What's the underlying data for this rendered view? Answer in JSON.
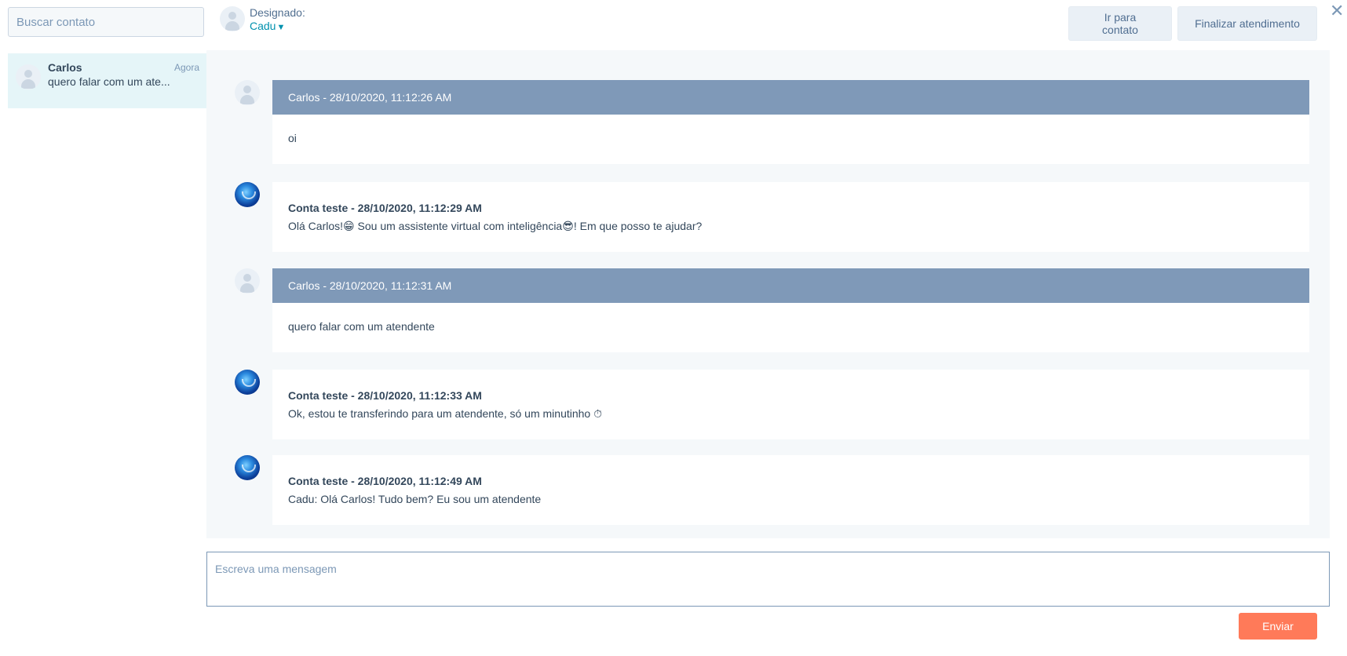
{
  "sidebar": {
    "search_placeholder": "Buscar contato",
    "contacts": [
      {
        "name": "Carlos",
        "time": "Agora",
        "preview": "quero falar com um ate..."
      }
    ]
  },
  "header": {
    "assigned_label": "Designado:",
    "assigned_value": "Cadu",
    "assigned_caret": "▼",
    "goto_contact_label": "Ir para contato",
    "finish_label": "Finalizar atendimento",
    "close_glyph": "✕"
  },
  "messages": [
    {
      "sender": "contact",
      "header": "Carlos - 28/10/2020, 11:12:26 AM",
      "text": "oi"
    },
    {
      "sender": "bot",
      "header": "Conta teste - 28/10/2020, 11:12:29 AM",
      "text_parts": [
        "Olá Carlos!",
        "😁",
        " Sou um assistente virtual com inteligência",
        "😎",
        "! Em que posso te ajudar?"
      ]
    },
    {
      "sender": "contact",
      "header": "Carlos - 28/10/2020, 11:12:31 AM",
      "text": "quero falar com um atendente"
    },
    {
      "sender": "bot",
      "header": "Conta teste - 28/10/2020, 11:12:33 AM",
      "text_parts": [
        "Ok, estou te transferindo para um atendente, só um minutinho ",
        "⏱"
      ]
    },
    {
      "sender": "bot",
      "header": "Conta teste - 28/10/2020, 11:12:49 AM",
      "text": "Cadu: Olá Carlos! Tudo bem? Eu sou um atendente"
    }
  ],
  "composer": {
    "placeholder": "Escreva uma mensagem",
    "send_label": "Enviar"
  },
  "colors": {
    "contact_header_bg": "#7f99b8",
    "chat_bg": "#f5f8fa",
    "send_button": "#ff7a59",
    "link": "#0091ae"
  }
}
